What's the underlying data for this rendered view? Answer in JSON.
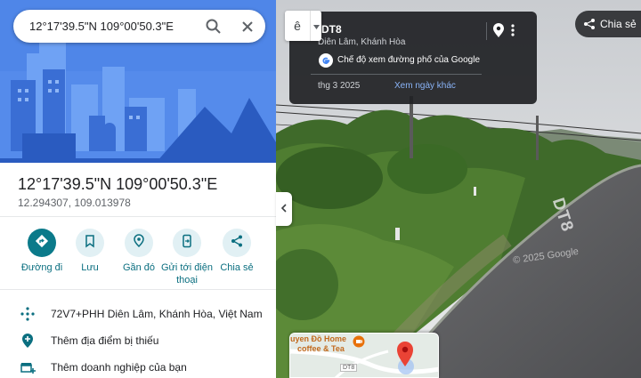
{
  "search": {
    "query": "12°17'39.5\"N 109°00'50.3\"E"
  },
  "place": {
    "title": "12°17'39.5\"N 109°00'50.3\"E",
    "coords": "12.294307, 109.013978"
  },
  "actions": [
    {
      "label": "Đường đi",
      "icon": "directions-icon"
    },
    {
      "label": "Lưu",
      "icon": "bookmark-icon"
    },
    {
      "label": "Gần đó",
      "icon": "nearby-icon"
    },
    {
      "label": "Gửi tới điện thoại",
      "icon": "send-to-phone-icon"
    },
    {
      "label": "Chia sẻ",
      "icon": "share-icon"
    }
  ],
  "details": [
    {
      "text": "72V7+PHH Diên Lâm, Khánh Hòa, Việt Nam",
      "icon": "plus-code-icon"
    },
    {
      "text": "Thêm địa điểm bị thiếu",
      "icon": "add-place-icon"
    },
    {
      "text": "Thêm doanh nghiệp của bạn",
      "icon": "add-business-icon"
    }
  ],
  "streetview": {
    "road_name": "DT8",
    "location": "Diên Lâm, Khánh Hòa",
    "mode_label": "Chế độ xem đường phố của Google",
    "date": "thg 3 2025",
    "other_dates": "Xem ngày khác",
    "share_label": "Chia sẻ",
    "road_marking": "DT8",
    "watermark": "© 2025 Google",
    "peg_label": "ê"
  },
  "minimap": {
    "place": "uyen Đồ Home",
    "place2": "coffee & Tea",
    "road": "DT8"
  },
  "colors": {
    "accent": "#0b7a8a",
    "hero_bg": "#4f86e8",
    "pin": "#ea4335"
  }
}
